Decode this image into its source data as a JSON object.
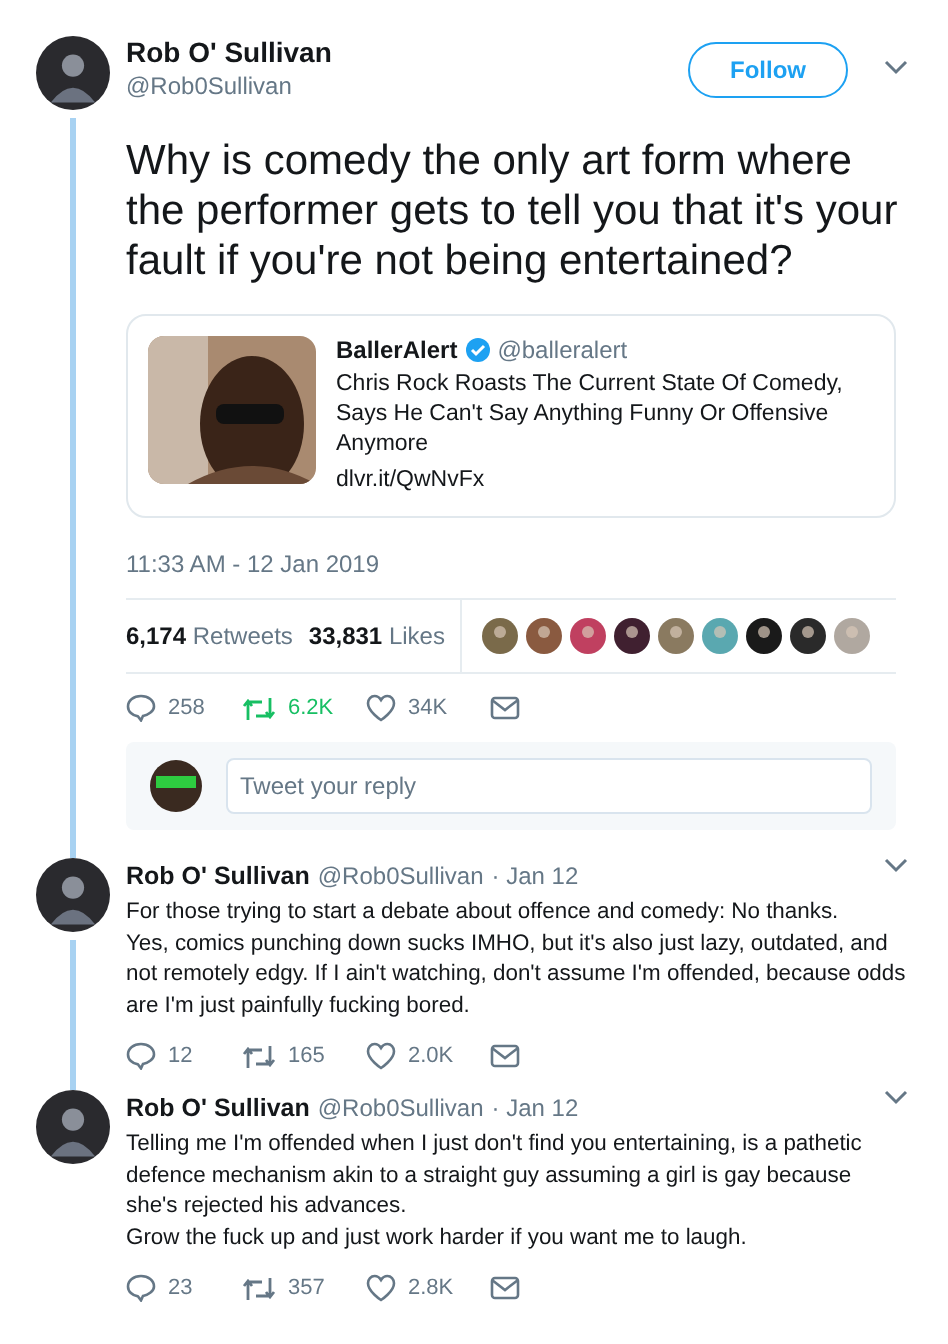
{
  "tweet": {
    "name": "Rob O' Sullivan",
    "handle": "@Rob0Sullivan",
    "follow_label": "Follow",
    "text": "Why is comedy the only art form where the performer gets to tell you that it's your fault if you're not being entertained?",
    "quote": {
      "name": "BallerAlert",
      "verified": true,
      "handle": "@balleralert",
      "text": "Chris Rock Roasts The Current State Of Comedy, Says He Can't Say Anything Funny Or Offensive Anymore",
      "link": "dlvr.it/QwNvFx"
    },
    "time": "11:33 AM - 12 Jan 2019",
    "stats": [
      {
        "count": "6,174",
        "label": "Retweets"
      },
      {
        "count": "33,831",
        "label": "Likes"
      }
    ],
    "actions": {
      "replies": "258",
      "retweets": "6.2K",
      "retweeted": true,
      "likes": "34K"
    },
    "reply_box": {
      "placeholder": "Tweet your reply"
    }
  },
  "replies": [
    {
      "name": "Rob O' Sullivan",
      "handle": "@Rob0Sullivan",
      "date": "· Jan 12",
      "text": "For those trying to start a debate about offence and comedy: No thanks.\nYes, comics punching down sucks IMHO, but it's also just lazy, outdated, and not remotely edgy. If I ain't watching, don't assume I'm offended, because odds are I'm just painfully fucking bored.",
      "actions": {
        "replies": "12",
        "retweets": "165",
        "retweeted": false,
        "likes": "2.0K"
      }
    },
    {
      "name": "Rob O' Sullivan",
      "handle": "@Rob0Sullivan",
      "date": "· Jan 12",
      "text": "Telling me I'm offended when I just don't find you entertaining, is a pathetic defence mechanism akin to a straight guy assuming a girl is gay because she's rejected his advances.\nGrow the fuck up and just work harder if you want me to laugh.",
      "actions": {
        "replies": "23",
        "retweets": "357",
        "retweeted": false,
        "likes": "2.8K"
      }
    }
  ]
}
